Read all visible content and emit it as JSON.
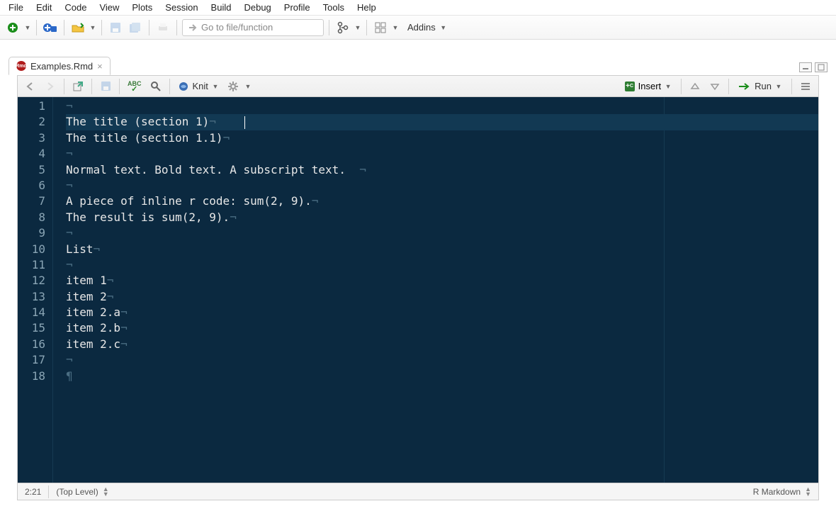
{
  "menu": [
    "File",
    "Edit",
    "Code",
    "View",
    "Plots",
    "Session",
    "Build",
    "Debug",
    "Profile",
    "Tools",
    "Help"
  ],
  "main_toolbar": {
    "goto_placeholder": "Go to file/function",
    "addins_label": "Addins"
  },
  "tab": {
    "filename": "Examples.Rmd"
  },
  "editor_toolbar": {
    "knit_label": "Knit",
    "insert_label": "Insert",
    "run_label": "Run",
    "abc_label": "ABC"
  },
  "editor": {
    "lines": [
      "",
      "The title (section 1)",
      "The title (section 1.1)",
      "",
      "Normal text. Bold text. A subscript text.  ",
      "",
      "A piece of inline r code: sum(2, 9).",
      "The result is sum(2, 9).",
      "",
      "List",
      "",
      "item 1",
      "item 2",
      "item 2.a",
      "item 2.b",
      "item 2.c",
      "",
      ""
    ],
    "highlighted_line_index": 1,
    "cursor_line": 2,
    "cursor_col": 21
  },
  "statusbar": {
    "position": "2:21",
    "scope": "(Top Level)",
    "language": "R Markdown"
  }
}
